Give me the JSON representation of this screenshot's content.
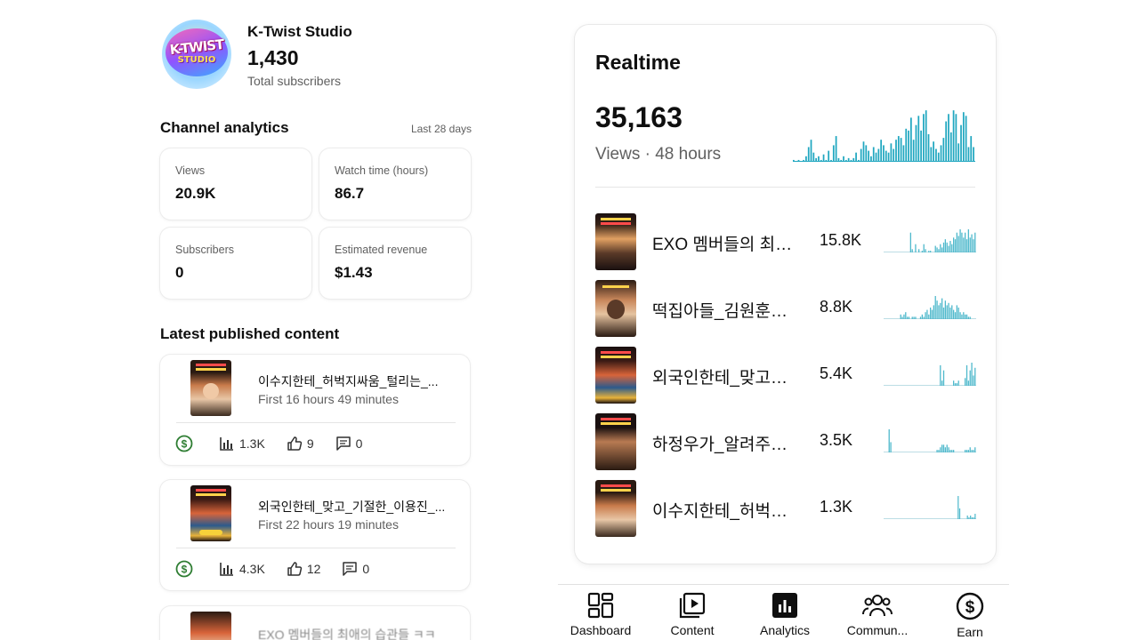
{
  "channel": {
    "name": "K-Twist Studio",
    "logo_text_top": "K-TWIST",
    "logo_text_bottom": "STUDIO",
    "subscribers": "1,430",
    "subscribers_label": "Total subscribers"
  },
  "analytics": {
    "title": "Channel analytics",
    "period": "Last 28 days",
    "cards": [
      {
        "label": "Views",
        "value": "20.9K"
      },
      {
        "label": "Watch time (hours)",
        "value": "86.7"
      },
      {
        "label": "Subscribers",
        "value": "0"
      },
      {
        "label": "Estimated revenue",
        "value": "$1.43"
      }
    ]
  },
  "latest": {
    "title": "Latest published content",
    "items": [
      {
        "title": "이수지한테_허벅지싸움_털리는_...",
        "time": "First 16 hours 49 minutes",
        "views": "1.3K",
        "likes": "9",
        "comments": "0"
      },
      {
        "title": "외국인한테_맞고_기절한_이용진_...",
        "time": "First 22 hours 19 minutes",
        "views": "4.3K",
        "likes": "12",
        "comments": "0"
      }
    ],
    "peek_text": "EXO 멤버들의 최애의 습관들 ㅋㅋ"
  },
  "realtime": {
    "title": "Realtime",
    "views": "35,163",
    "views_label": "Views · 48 hours",
    "chart_data": {
      "type": "bar",
      "values": [
        1,
        0,
        1,
        0,
        1,
        3,
        8,
        12,
        5,
        2,
        3,
        1,
        4,
        1,
        6,
        1,
        9,
        14,
        2,
        1,
        3,
        1,
        2,
        1,
        2,
        5,
        1,
        7,
        11,
        9,
        6,
        3,
        8,
        5,
        7,
        12,
        9,
        6,
        5,
        10,
        7,
        12,
        14,
        13,
        9,
        18,
        17,
        24,
        12,
        20,
        25,
        17,
        26,
        28,
        15,
        8,
        11,
        7,
        5,
        9,
        13,
        22,
        26,
        16,
        28,
        26,
        10,
        20,
        27,
        25,
        8,
        14,
        8
      ],
      "max": 30
    },
    "videos": [
      {
        "title": "EXO 멤버들의 최애의 습관들",
        "views": "15.8K",
        "spark": [
          0,
          0,
          0,
          0,
          0,
          0,
          0,
          0,
          0,
          0,
          0,
          0,
          0,
          0,
          0,
          0,
          12,
          2,
          0,
          5,
          0,
          2,
          0,
          1,
          5,
          2,
          0,
          1,
          1,
          0,
          0,
          4,
          3,
          2,
          5,
          3,
          6,
          8,
          6,
          4,
          7,
          5,
          9,
          8,
          12,
          10,
          14,
          12,
          9,
          12,
          8,
          14,
          9,
          11,
          8,
          12
        ]
      },
      {
        "title": "떡집아들_김원훈의 고백",
        "views": "8.8K",
        "spark": [
          0,
          0,
          0,
          0,
          0,
          0,
          0,
          0,
          0,
          0,
          2,
          1,
          2,
          3,
          1,
          1,
          0,
          1,
          1,
          1,
          0,
          0,
          1,
          2,
          1,
          3,
          4,
          2,
          5,
          4,
          6,
          10,
          8,
          6,
          7,
          9,
          5,
          8,
          6,
          7,
          5,
          6,
          4,
          3,
          6,
          5,
          3,
          2,
          3,
          2,
          2,
          1,
          1,
          0,
          0,
          0
        ]
      },
      {
        "title": "외국인한테_맞고_기절한_이용진",
        "views": "5.4K",
        "spark": [
          0,
          0,
          0,
          0,
          0,
          0,
          0,
          0,
          0,
          0,
          0,
          0,
          0,
          0,
          0,
          0,
          0,
          0,
          0,
          0,
          0,
          0,
          0,
          0,
          0,
          0,
          0,
          0,
          0,
          0,
          0,
          0,
          0,
          0,
          8,
          2,
          6,
          0,
          0,
          0,
          0,
          0,
          2,
          1,
          1,
          2,
          0,
          0,
          0,
          3,
          8,
          2,
          6,
          9,
          4,
          7
        ]
      },
      {
        "title": "하정우가_알려주는_비법",
        "views": "3.5K",
        "spark": [
          0,
          0,
          0,
          9,
          4,
          0,
          0,
          0,
          0,
          0,
          0,
          0,
          0,
          0,
          0,
          0,
          0,
          0,
          0,
          0,
          0,
          0,
          0,
          0,
          0,
          0,
          0,
          0,
          0,
          0,
          0,
          0,
          1,
          1,
          2,
          3,
          3,
          2,
          3,
          2,
          1,
          1,
          1,
          0,
          0,
          0,
          0,
          0,
          0,
          1,
          1,
          1,
          2,
          1,
          1,
          2
        ]
      },
      {
        "title": "이수지한테_허벅지싸움_털리는",
        "views": "1.3K",
        "spark": [
          0,
          0,
          0,
          0,
          0,
          0,
          0,
          0,
          0,
          0,
          0,
          0,
          0,
          0,
          0,
          0,
          0,
          0,
          0,
          0,
          0,
          0,
          0,
          0,
          0,
          0,
          0,
          0,
          0,
          0,
          0,
          0,
          0,
          0,
          0,
          0,
          0,
          0,
          0,
          0,
          0,
          0,
          0,
          0,
          0,
          0,
          0,
          0,
          13,
          6,
          0,
          0,
          0,
          0,
          2,
          1,
          2,
          1,
          1,
          3
        ]
      }
    ]
  },
  "nav": {
    "items": [
      {
        "label": "Dashboard",
        "icon": "dashboard-icon",
        "active": false
      },
      {
        "label": "Content",
        "icon": "content-icon",
        "active": false
      },
      {
        "label": "Analytics",
        "icon": "analytics-icon",
        "active": true
      },
      {
        "label": "Commun...",
        "icon": "community-icon",
        "active": false
      },
      {
        "label": "Earn",
        "icon": "earn-icon",
        "active": false
      }
    ]
  },
  "colors": {
    "chart_bar": "#20a7c0",
    "chart_bar_light": "#4fb9cc",
    "revenue_green": "#2e7d32",
    "text_primary": "#0f0f0f",
    "text_secondary": "#606060"
  }
}
